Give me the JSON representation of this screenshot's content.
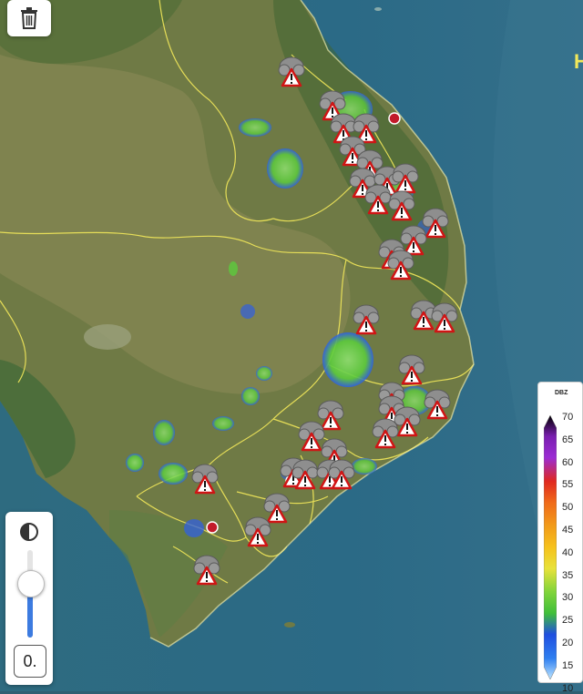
{
  "map": {
    "coastline_note": "",
    "edge_label": "H"
  },
  "controls": {
    "trash_icon": "trash-icon",
    "opacity_icon": "half-circle-icon",
    "opacity_value": "0.",
    "opacity_level": 0.62
  },
  "legend": {
    "unit": "DBZ",
    "ticks": [
      "70",
      "65",
      "60",
      "55",
      "50",
      "45",
      "40",
      "35",
      "30",
      "25",
      "20",
      "15",
      "10"
    ],
    "colors": [
      "#000000",
      "#7a1fb0",
      "#9b2cd4",
      "#e0281f",
      "#f06a1a",
      "#f29c1a",
      "#f6c21c",
      "#e8e23a",
      "#7fd43a",
      "#3fbf3a",
      "#1f4fe0",
      "#2f7ff0",
      "#bfe6ff"
    ]
  },
  "markers": {
    "storm_icon": "thunderstorm-warning-icon",
    "station_icon": "red-dot-icon"
  }
}
